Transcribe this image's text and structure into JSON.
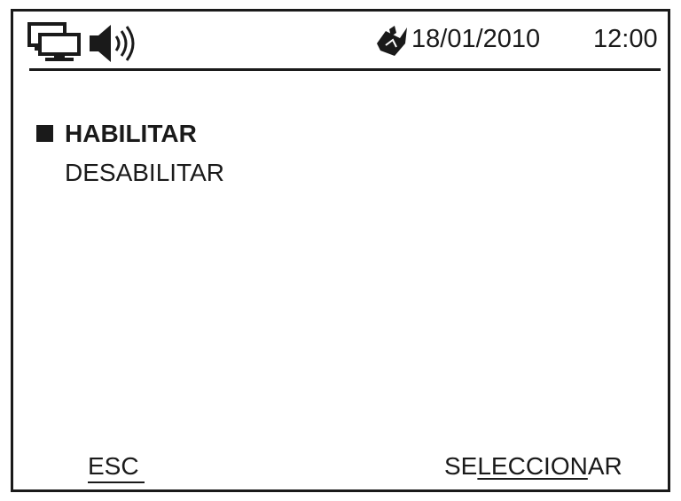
{
  "status_bar": {
    "icons": [
      "network-icon",
      "speaker-icon",
      "battery-charging-icon"
    ],
    "date": "18/01/2010",
    "time": "12:00"
  },
  "menu": {
    "items": [
      {
        "label": "HABILITAR",
        "selected": true
      },
      {
        "label": "DESABILITAR",
        "selected": false
      }
    ]
  },
  "softkeys": {
    "left": "ESC",
    "right_prefix": "SE",
    "right_underlined": "LECCION",
    "right_suffix": "AR"
  },
  "colors": {
    "foreground": "#1a1a1a",
    "background": "#ffffff"
  }
}
